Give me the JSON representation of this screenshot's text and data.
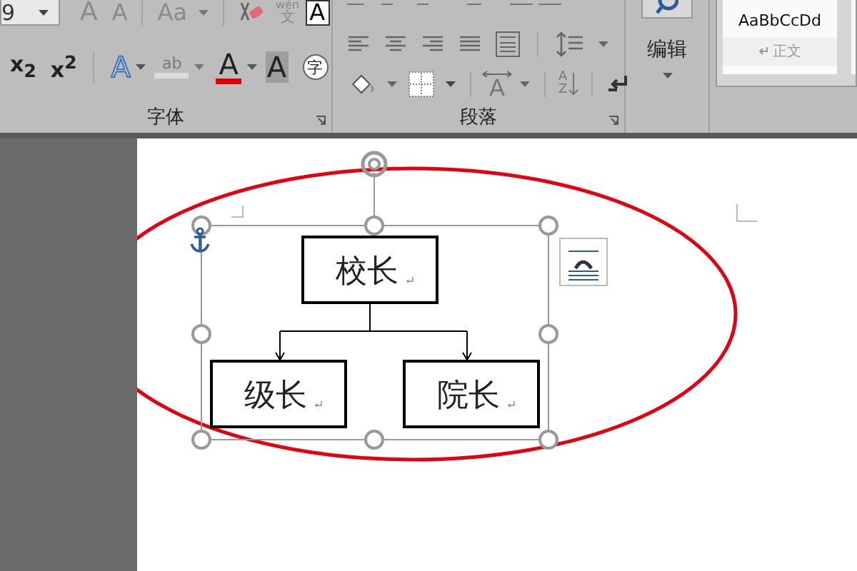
{
  "font_group": {
    "size_value": "9",
    "grow": "A",
    "shrink": "A",
    "case": "Aa",
    "phonetic_top": "wén",
    "phonetic_bottom": "文",
    "border_char": "A",
    "subscript": "x$_{2}$",
    "superscript": "x$^{2}$",
    "text_effect": "A",
    "highlight": "ab",
    "font_color": "A",
    "shading": "A",
    "enclose": "字",
    "label": "字体"
  },
  "paragraph_group": {
    "layout_char": "A",
    "sort_top": "A",
    "sort_bottom": "Z",
    "label": "段落"
  },
  "editing_group": {
    "label": "编辑"
  },
  "styles": [
    {
      "sample": "AaBbCcDd",
      "name": "正文"
    }
  ],
  "diagram": {
    "selected": true,
    "nodes": [
      {
        "label": "校长"
      },
      {
        "label": "级长"
      },
      {
        "label": "院长"
      }
    ]
  }
}
